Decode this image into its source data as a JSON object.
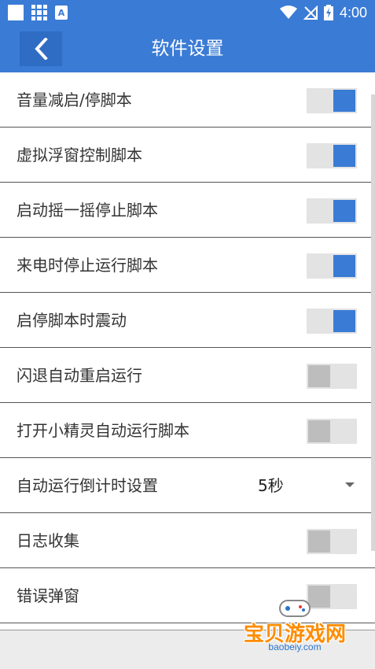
{
  "status_bar": {
    "time": "4:00",
    "app_icon_letter": "A",
    "icons": [
      "notification-square-icon",
      "grid-app-icon",
      "a-app-icon",
      "wifi-icon",
      "no-signal-icon",
      "battery-charging-icon"
    ]
  },
  "header": {
    "title": "软件设置",
    "back_icon": "chevron-left-icon"
  },
  "settings": [
    {
      "label": "音量减启/停脚本",
      "type": "toggle",
      "on": true
    },
    {
      "label": "虚拟浮窗控制脚本",
      "type": "toggle",
      "on": true
    },
    {
      "label": "启动摇一摇停止脚本",
      "type": "toggle",
      "on": true
    },
    {
      "label": "来电时停止运行脚本",
      "type": "toggle",
      "on": true
    },
    {
      "label": "启停脚本时震动",
      "type": "toggle",
      "on": true
    },
    {
      "label": "闪退自动重启运行",
      "type": "toggle",
      "on": false
    },
    {
      "label": "打开小精灵自动运行脚本",
      "type": "toggle",
      "on": false
    },
    {
      "label": "自动运行倒计时设置",
      "type": "select",
      "value": "5秒"
    },
    {
      "label": "日志收集",
      "type": "toggle",
      "on": false
    },
    {
      "label": "错误弹窗",
      "type": "toggle",
      "on": false
    }
  ],
  "watermark": {
    "text": "宝贝游戏网",
    "url": "baobeiy.com"
  },
  "colors": {
    "primary": "#3a7bd5",
    "toggle_off_thumb": "#bdbdbd",
    "toggle_track": "#e3e3e3"
  }
}
